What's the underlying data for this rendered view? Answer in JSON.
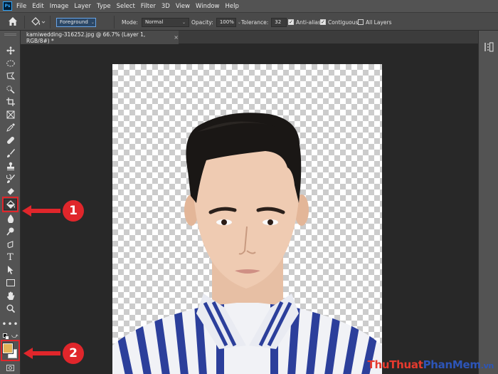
{
  "menu": {
    "logo": "Ps",
    "items": [
      "File",
      "Edit",
      "Image",
      "Layer",
      "Type",
      "Select",
      "Filter",
      "3D",
      "View",
      "Window",
      "Help"
    ]
  },
  "options": {
    "fill_source": "Foreground",
    "mode_label": "Mode:",
    "mode_value": "Normal",
    "opacity_label": "Opacity:",
    "opacity_value": "100%",
    "tolerance_label": "Tolerance:",
    "tolerance_value": "32",
    "anti_alias": {
      "label": "Anti-alias",
      "checked": true
    },
    "contiguous": {
      "label": "Contiguous",
      "checked": true
    },
    "all_layers": {
      "label": "All Layers",
      "checked": false
    }
  },
  "document_tab": {
    "title": "kamiwedding-316252.jpg @ 66.7% (Layer 1, RGB/8#) *",
    "close": "×"
  },
  "tools": [
    "move-tool",
    "marquee-tool",
    "lasso-tool",
    "quick-select-tool",
    "crop-tool",
    "frame-tool",
    "eyedropper-tool",
    "healing-brush-tool",
    "brush-tool",
    "clone-stamp-tool",
    "history-brush-tool",
    "eraser-tool",
    "paint-bucket-tool",
    "blur-tool",
    "dodge-tool",
    "pen-tool",
    "type-tool",
    "path-select-tool",
    "rectangle-tool",
    "hand-tool",
    "zoom-tool",
    "more-tools"
  ],
  "swatches": {
    "foreground": "#e2b257",
    "background": "#ffffff"
  },
  "callouts": [
    {
      "number": "1",
      "target": "paint-bucket-tool"
    },
    {
      "number": "2",
      "target": "color-swatches"
    }
  ],
  "colors": {
    "highlight": "#e0262b",
    "accent": "#6aa5e6"
  },
  "watermark": {
    "part1": "Thu",
    "part2": "Thuat",
    "part3": "PhanMem",
    "part4": ".vn"
  }
}
